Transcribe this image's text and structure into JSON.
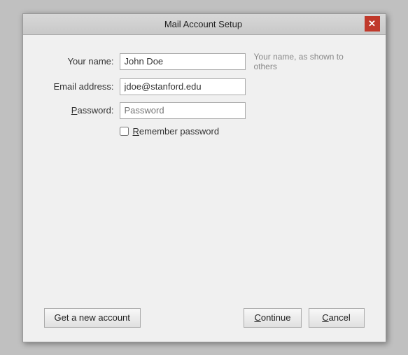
{
  "dialog": {
    "title": "Mail Account Setup",
    "close_label": "✕"
  },
  "form": {
    "name_label": "Your name:",
    "name_value": "John Doe",
    "name_hint": "Your name, as shown to others",
    "email_label": "Email address:",
    "email_value": "jdoe@stanford.edu",
    "password_label": "Password:",
    "password_placeholder": "Password",
    "remember_label": "Remember password"
  },
  "buttons": {
    "get_account": "Get a new account",
    "continue": "Continue",
    "cancel": "Cancel"
  }
}
